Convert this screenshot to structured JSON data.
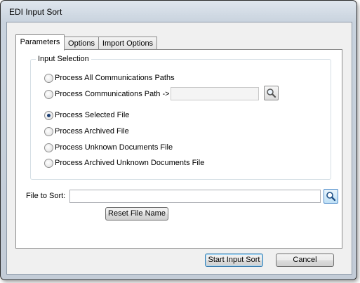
{
  "window": {
    "title": "EDI Input Sort"
  },
  "tabs": [
    {
      "label": "Parameters",
      "active": true
    },
    {
      "label": "Options",
      "active": false
    },
    {
      "label": "Import Options",
      "active": false
    }
  ],
  "input_selection": {
    "group_label": "Input Selection",
    "options": [
      {
        "label": "Process All Communications Paths",
        "checked": false
      },
      {
        "label": "Process Communications Path ->",
        "checked": false
      },
      {
        "label": "Process Selected File",
        "checked": true
      },
      {
        "label": "Process Archived File",
        "checked": false
      },
      {
        "label": "Process Unknown Documents File",
        "checked": false
      },
      {
        "label": "Process Archived Unknown Documents File",
        "checked": false
      }
    ],
    "comm_path_value": "",
    "comm_path_icon": "search-icon"
  },
  "file_to_sort": {
    "label": "File to Sort:",
    "value": "",
    "browse_icon": "search-icon",
    "reset_label": "Reset File Name"
  },
  "footer": {
    "start_label": "Start Input Sort",
    "cancel_label": "Cancel"
  }
}
